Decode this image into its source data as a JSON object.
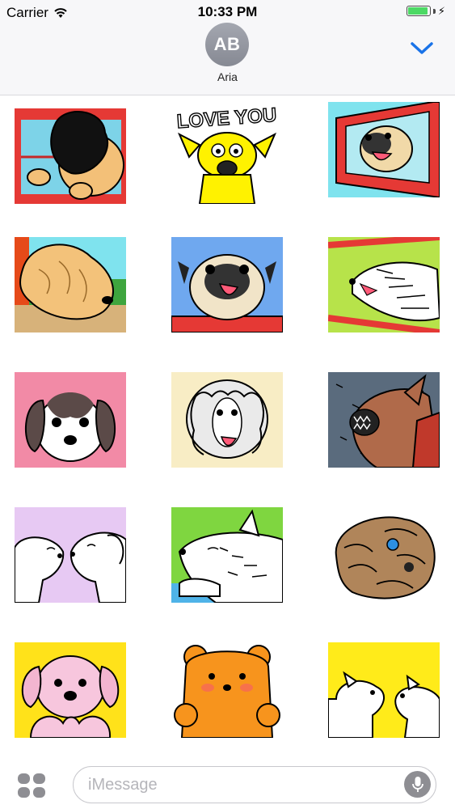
{
  "status_bar": {
    "carrier": "Carrier",
    "time": "10:33 PM",
    "battery_level": 0.95
  },
  "header": {
    "avatar_initials": "AB",
    "contact_name": "Aria"
  },
  "stickers": [
    {
      "id": "dog-hair-car-window"
    },
    {
      "id": "love-you-dog",
      "text": "LOVE YOU"
    },
    {
      "id": "pug-car-mirror"
    },
    {
      "id": "golden-dog-car"
    },
    {
      "id": "pug-tongue"
    },
    {
      "id": "white-dog-wind"
    },
    {
      "id": "beagle-puppy"
    },
    {
      "id": "poodle-tongue"
    },
    {
      "id": "angry-dog-rain"
    },
    {
      "id": "two-dogs-kiss"
    },
    {
      "id": "white-dog-green"
    },
    {
      "id": "wrinkly-dog"
    },
    {
      "id": "pink-puppy"
    },
    {
      "id": "orange-bear"
    },
    {
      "id": "white-dogs-yellow"
    }
  ],
  "composer": {
    "placeholder": "iMessage"
  }
}
